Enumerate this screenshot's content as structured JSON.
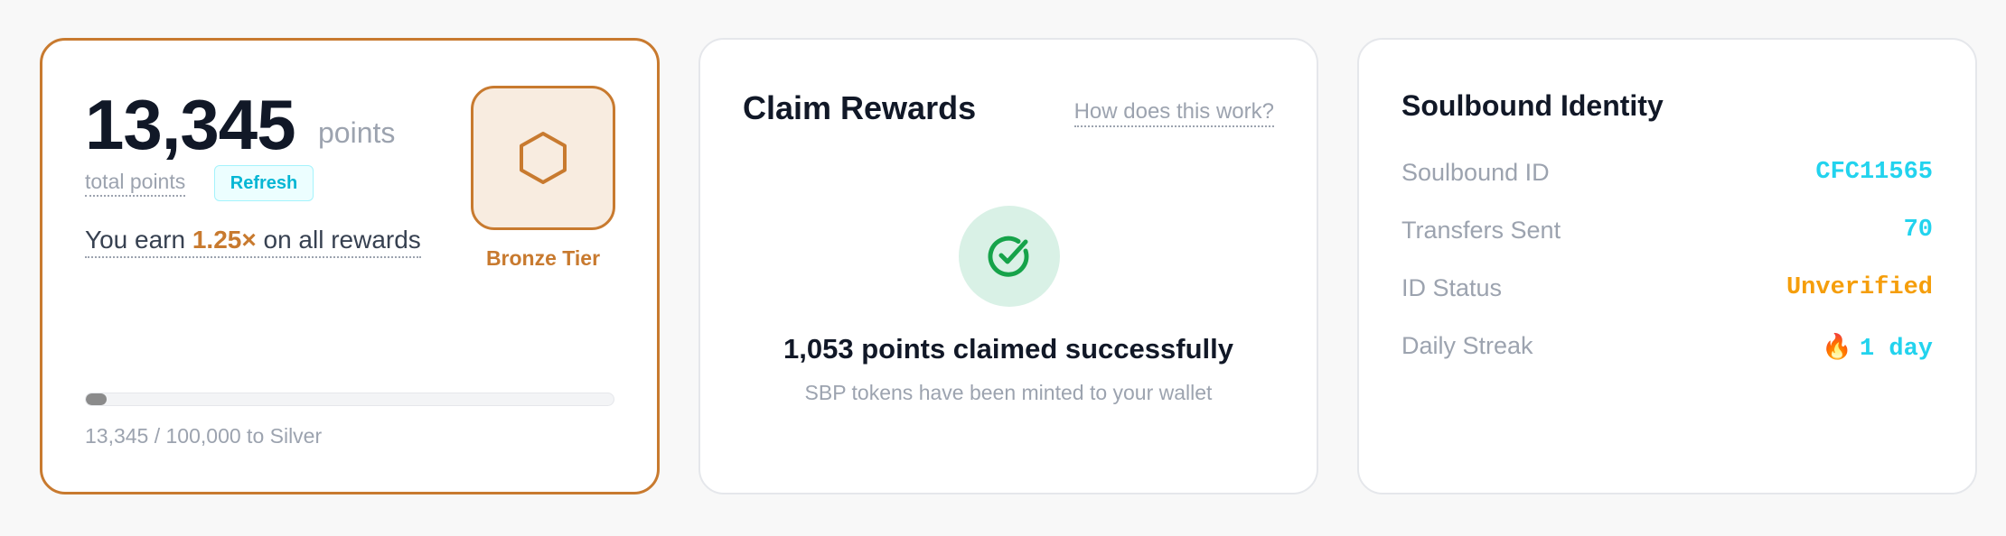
{
  "points_card": {
    "total": "13,345",
    "unit": "points",
    "total_label": "total points",
    "refresh_label": "Refresh",
    "earn_prefix": "You earn ",
    "earn_multiplier": "1.25×",
    "earn_suffix": " on all rewards",
    "tier_icon": "hexagon-icon",
    "tier_label": "Bronze Tier",
    "progress_fraction": 0.13345,
    "progress_text": "13,345 / 100,000 to Silver"
  },
  "claim_card": {
    "title": "Claim Rewards",
    "help_link": "How does this work?",
    "success_icon": "check-circle-icon",
    "message": "1,053 points claimed successfully",
    "subtext": "SBP tokens have been minted to your wallet"
  },
  "identity_card": {
    "title": "Soulbound Identity",
    "rows": [
      {
        "label": "Soulbound ID",
        "value": "CFC11565"
      },
      {
        "label": "Transfers Sent",
        "value": "70"
      },
      {
        "label": "ID Status",
        "value": "Unverified"
      },
      {
        "label": "Daily Streak",
        "icon": "🔥",
        "value": "1 day"
      }
    ]
  },
  "colors": {
    "bronze": "#c87a2f",
    "cyan": "#22d3ee",
    "amber": "#f59e0b",
    "success_green": "#16a34a"
  }
}
